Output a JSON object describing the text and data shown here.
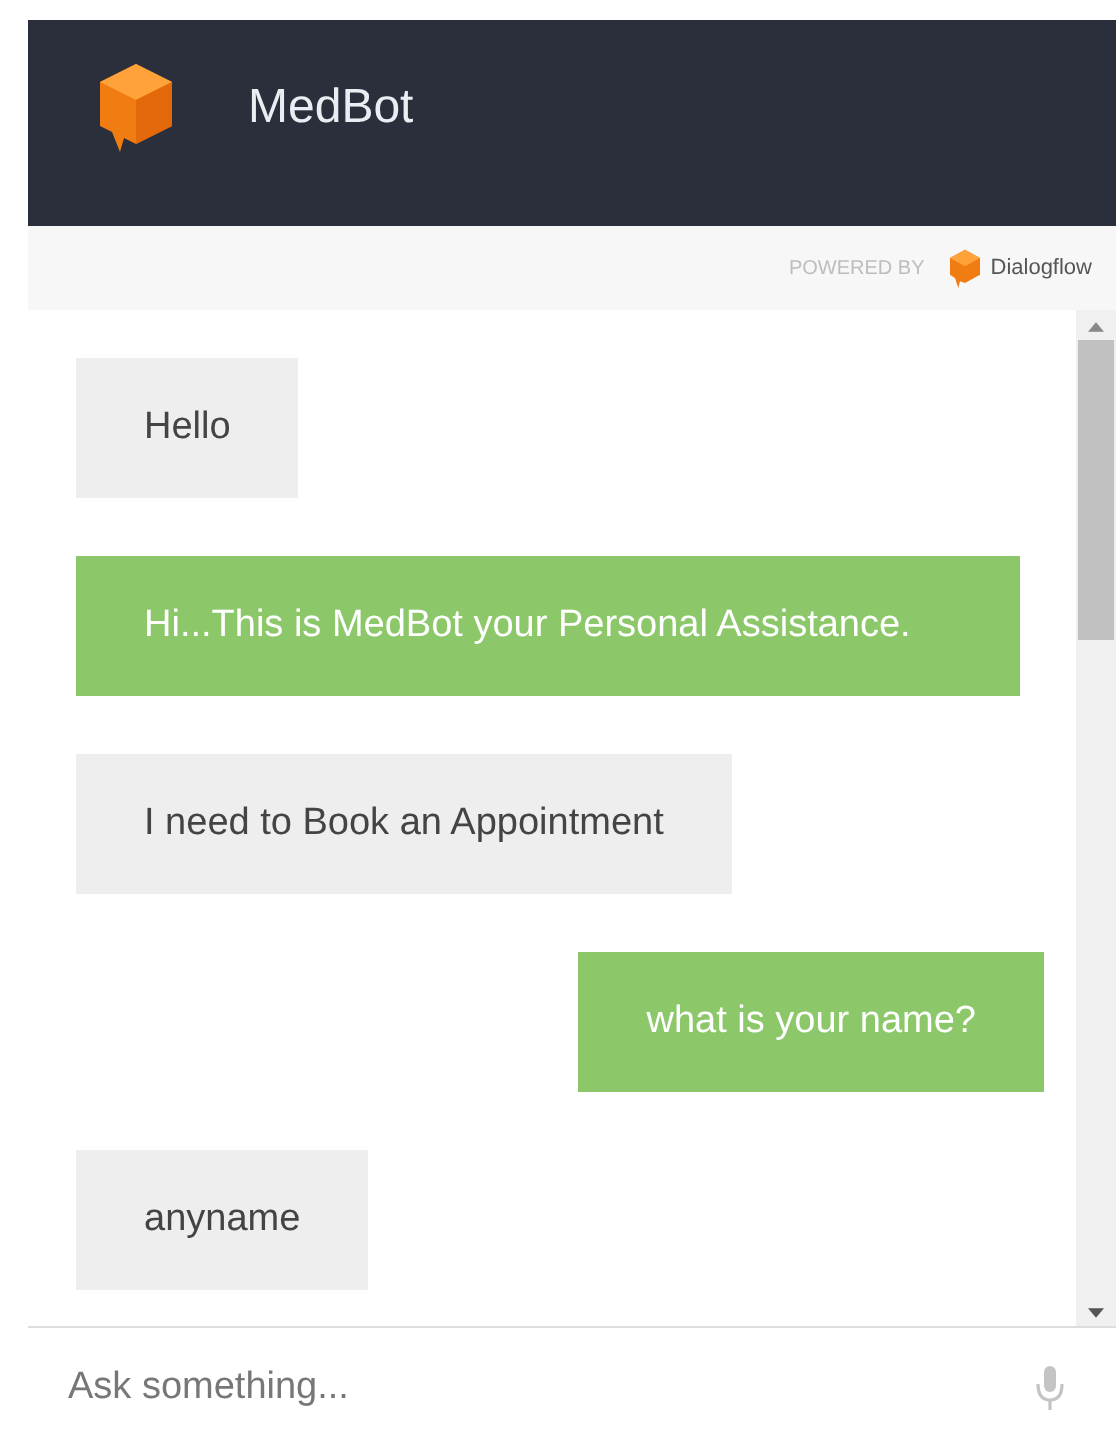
{
  "header": {
    "title": "MedBot"
  },
  "powered_by": {
    "label": "POWERED BY",
    "brand": "Dialogflow"
  },
  "messages": [
    {
      "kind": "user",
      "text": "Hello"
    },
    {
      "kind": "bot",
      "text": "Hi...This is MedBot your Personal Assistance."
    },
    {
      "kind": "user",
      "text": "I need to Book an Appointment"
    },
    {
      "kind": "bot",
      "text": "what is your name?"
    },
    {
      "kind": "user",
      "text": "anyname"
    }
  ],
  "input": {
    "placeholder": "Ask something..."
  }
}
